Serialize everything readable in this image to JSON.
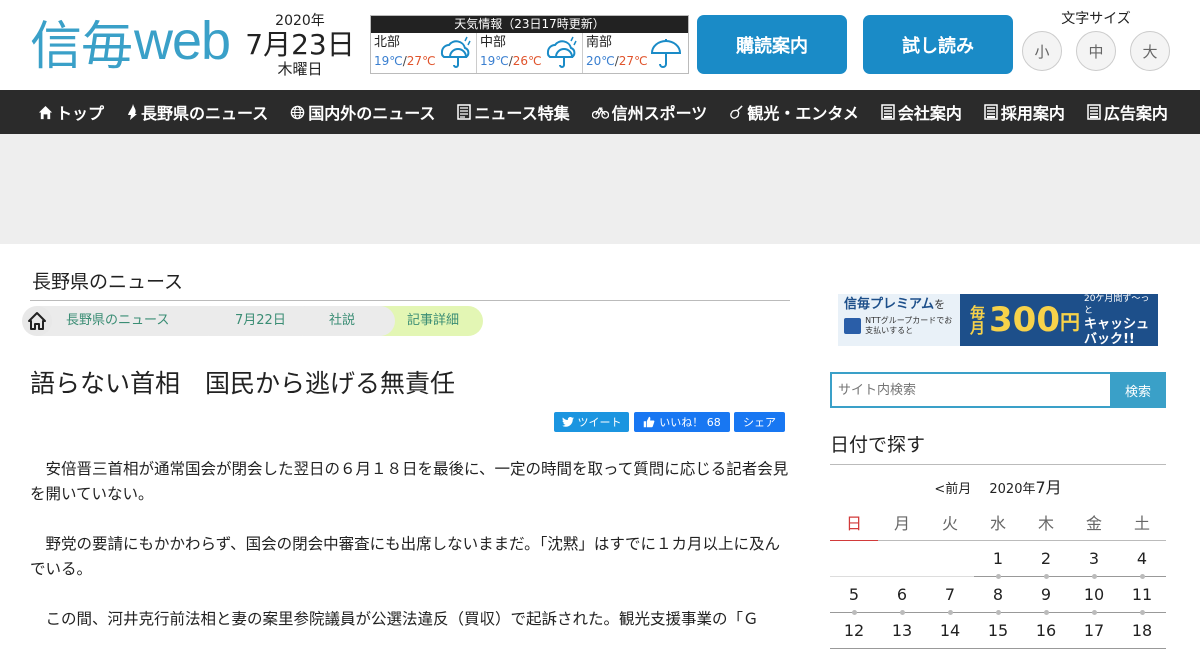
{
  "header": {
    "logo_kanji": "信毎",
    "logo_web": "web",
    "date": {
      "year": "2020年",
      "month_day": "7月23日",
      "weekday": "木曜日"
    },
    "weather": {
      "title": "天気情報（23日17時更新）",
      "regions": [
        {
          "name": "北部",
          "low": "19℃",
          "high": "27℃",
          "icon": "rain-umbrella-icon"
        },
        {
          "name": "中部",
          "low": "19℃",
          "high": "26℃",
          "icon": "rain-umbrella-icon"
        },
        {
          "name": "南部",
          "low": "20℃",
          "high": "27℃",
          "icon": "umbrella-icon"
        }
      ]
    },
    "subscribe_label": "購読案内",
    "trial_label": "試し読み",
    "font_size": {
      "label": "文字サイズ",
      "small": "小",
      "medium": "中",
      "large": "大"
    }
  },
  "nav": {
    "items": [
      {
        "label": "トップ",
        "icon": "home-icon"
      },
      {
        "label": "長野県のニュース",
        "icon": "flame-icon"
      },
      {
        "label": "国内外のニュース",
        "icon": "globe-icon"
      },
      {
        "label": "ニュース特集",
        "icon": "newspaper-icon"
      },
      {
        "label": "信州スポーツ",
        "icon": "bicycle-icon"
      },
      {
        "label": "観光・エンタメ",
        "icon": "guitar-icon"
      },
      {
        "label": "会社案内",
        "icon": "document-icon"
      },
      {
        "label": "採用案内",
        "icon": "document-icon"
      },
      {
        "label": "広告案内",
        "icon": "document-icon"
      }
    ]
  },
  "main": {
    "section_title": "長野県のニュース",
    "breadcrumbs": [
      "長野県のニュース",
      "7月22日",
      "社説",
      "記事詳細"
    ],
    "headline": "語らない首相　国民から逃げる無責任",
    "share": {
      "tweet": "ツイート",
      "like": "いいね！ 68",
      "share": "シェア"
    },
    "paragraphs": [
      "　安倍晋三首相が通常国会が閉会した翌日の６月１８日を最後に、一定の時間を取って質問に応じる記者会見を開いていない。",
      "　野党の要請にもかかわらず、国会の閉会中審査にも出席しないままだ。「沈黙」はすでに１カ月以上に及んでいる。",
      "　この間、河井克行前法相と妻の案里参院議員が公選法違反（買収）で起訴された。観光支援事業の「Ｇ"
    ]
  },
  "sidebar": {
    "banner": {
      "brand": "信毎プレミアム",
      "wo": "を",
      "card_text": "NTTグループカードでお支払いすると",
      "maitsuki": "毎月",
      "amount": "300",
      "yen": "円",
      "side1": "20ケ月間ず〜っと",
      "side2": "キャッシュバック!!"
    },
    "search": {
      "placeholder": "サイト内検索",
      "button": "検索"
    },
    "calendar": {
      "title": "日付で探す",
      "prev": "<前月",
      "year": "2020年",
      "month": "7月",
      "weekdays": [
        "日",
        "月",
        "火",
        "水",
        "木",
        "金",
        "土"
      ],
      "weeks": [
        [
          "",
          "",
          "",
          "1",
          "2",
          "3",
          "4"
        ],
        [
          "5",
          "6",
          "7",
          "8",
          "9",
          "10",
          "11"
        ],
        [
          "12",
          "13",
          "14",
          "15",
          "16",
          "17",
          "18"
        ]
      ]
    }
  },
  "colors": {
    "brand_blue": "#3aa0c8",
    "button_blue": "#1a8bc7",
    "nav_bg": "#2b2b2b",
    "low_temp": "#3a7fd0",
    "high_temp": "#e0532b",
    "sunday": "#d23a3a"
  }
}
